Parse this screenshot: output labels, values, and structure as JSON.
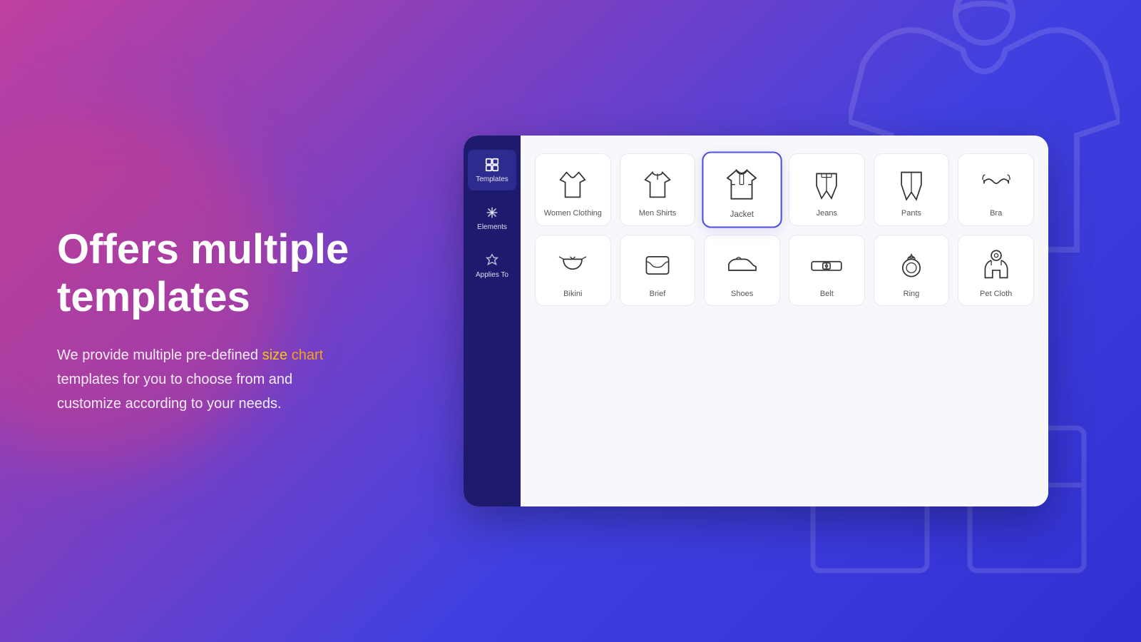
{
  "page": {
    "background": "linear-gradient(135deg, #c040a0 0%, #8040c0 30%, #4040e0 60%, #3030d0 100%)"
  },
  "left": {
    "heading_line1": "Offers multiple",
    "heading_line2": "templates",
    "description_before": "We provide multiple pre-defined ",
    "highlight1": "size",
    "highlight2": "chart",
    "description_after": " templates for you to choose from and customize according to your needs."
  },
  "sidebar": {
    "items": [
      {
        "id": "templates",
        "label": "Templates",
        "active": true
      },
      {
        "id": "elements",
        "label": "Elements",
        "active": false
      },
      {
        "id": "applies-to",
        "label": "Applies To",
        "active": false
      }
    ]
  },
  "templates": {
    "grid": [
      {
        "id": "women-clothing",
        "label": "Women Clothing",
        "selected": false
      },
      {
        "id": "men-shirts",
        "label": "Men Shirts",
        "selected": false
      },
      {
        "id": "jacket",
        "label": "Jacket",
        "selected": true
      },
      {
        "id": "jeans",
        "label": "Jeans",
        "selected": false
      },
      {
        "id": "pants",
        "label": "Pants",
        "selected": false
      },
      {
        "id": "bra",
        "label": "Bra",
        "selected": false
      },
      {
        "id": "bikini",
        "label": "Bikini",
        "selected": false
      },
      {
        "id": "brief",
        "label": "Brief",
        "selected": false
      },
      {
        "id": "shoes",
        "label": "Shoes",
        "selected": false
      },
      {
        "id": "belt",
        "label": "Belt",
        "selected": false
      },
      {
        "id": "ring",
        "label": "Ring",
        "selected": false
      },
      {
        "id": "pet-cloth",
        "label": "Pet Cloth",
        "selected": false
      }
    ]
  }
}
